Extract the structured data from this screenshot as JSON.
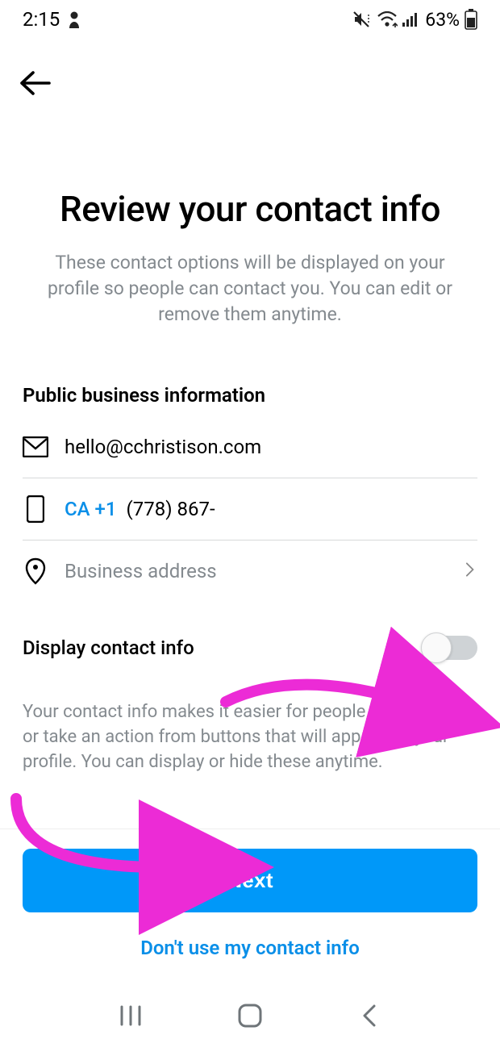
{
  "statusBar": {
    "time": "2:15",
    "batteryPct": "63%"
  },
  "page": {
    "title": "Review your contact info",
    "subtitle": "These contact options will be displayed on your profile so people can contact you. You can edit or remove them anytime.",
    "sectionLabel": "Public business information"
  },
  "fields": {
    "emailValue": "hello@cchristison.com",
    "phoneCountry": "CA +1",
    "phoneValue": "(778) 867-",
    "addressPlaceholder": "Business address"
  },
  "toggle": {
    "label": "Display contact info",
    "on": false,
    "info": "Your contact info makes it easier for people to email, call or take an action from buttons that will appear on your profile. You can display or hide these anytime."
  },
  "actions": {
    "nextLabel": "Next",
    "skipLabel": "Don't use my contact info"
  }
}
